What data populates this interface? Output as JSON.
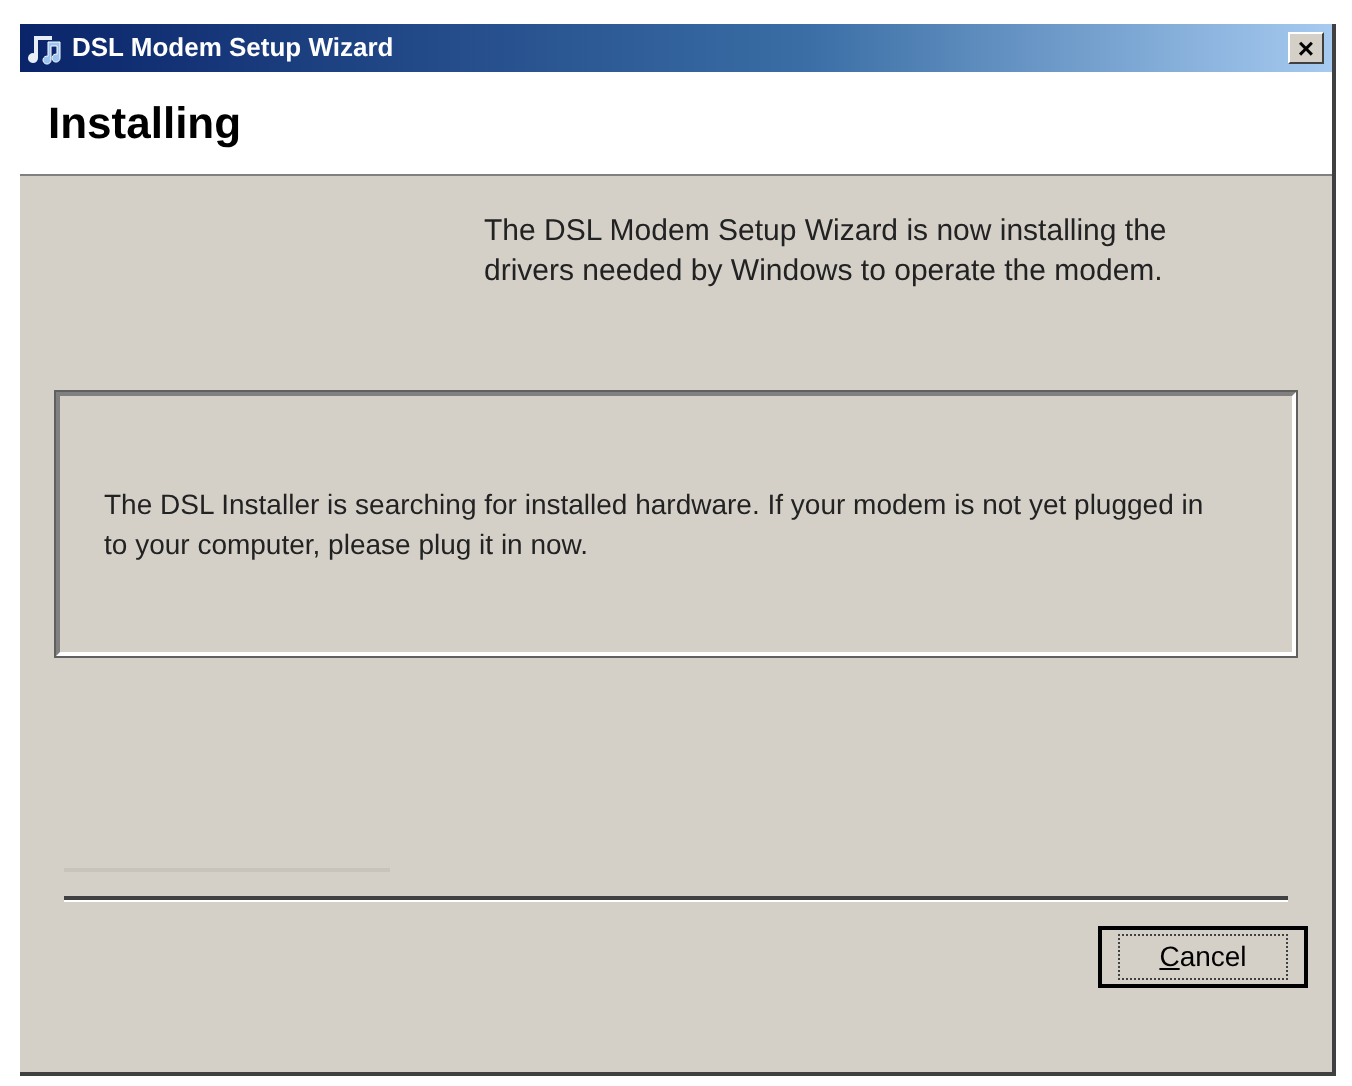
{
  "window": {
    "title": "DSL Modem Setup Wizard",
    "close": "×"
  },
  "header": {
    "title": "Installing"
  },
  "intro": "The DSL Modem Setup Wizard is now installing the drivers needed by Windows to operate the modem.",
  "status_box": {
    "message": "The DSL Installer is searching for installed hardware.  If your modem is not yet plugged in to your computer, please plug it in now."
  },
  "progress": {
    "level": 0
  },
  "buttons": [
    {
      "label": "Cancel",
      "accelerator_underlined": true
    }
  ]
}
